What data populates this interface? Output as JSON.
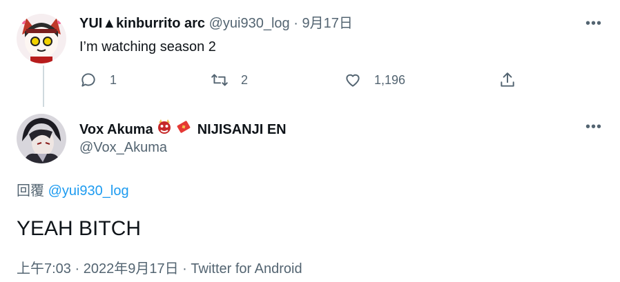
{
  "colors": {
    "text": "#0f1419",
    "secondary": "#536471",
    "link": "#1d9bf0",
    "thread_line": "#cfd9de"
  },
  "tweet1": {
    "display_name": "YUI▲kinburrito arc",
    "handle": "@yui930_log",
    "separator": "·",
    "date": "9月17日",
    "text": "I’m watching season 2",
    "reply_count": "1",
    "retweet_count": "2",
    "like_count": "1,196",
    "more_icon": "more-icon"
  },
  "tweet2": {
    "display_name": "Vox Akuma",
    "badge_emojis": [
      "oni-mask-emoji",
      "red-envelope-emoji"
    ],
    "affiliation": "NIJISANJI EN",
    "handle": "@Vox_Akuma",
    "reply_prefix": "回覆",
    "reply_handle": "@yui930_log",
    "text": "YEAH BITCH",
    "time": "上午7:03",
    "separator1": "·",
    "date": "2022年9月17日",
    "separator2": "·",
    "source": "Twitter for Android"
  }
}
